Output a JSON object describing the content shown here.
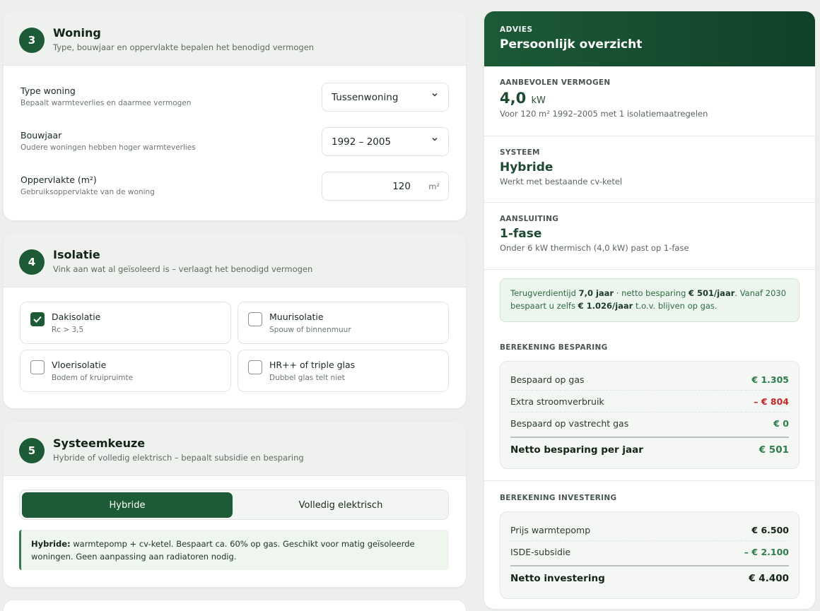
{
  "woning": {
    "step": "3",
    "title": "Woning",
    "subtitle": "Type, bouwjaar en oppervlakte bepalen het benodigd vermogen",
    "type_label": "Type woning",
    "type_help": "Bepaalt warmteverlies en daarmee vermogen",
    "type_value": "Tussenwoning",
    "bouwjaar_label": "Bouwjaar",
    "bouwjaar_help": "Oudere woningen hebben hoger warmteverlies",
    "bouwjaar_value": "1992 – 2005",
    "opp_label": "Oppervlakte (m²)",
    "opp_help": "Gebruiksoppervlakte van de woning",
    "opp_value": "120",
    "opp_unit": "m²"
  },
  "isolatie": {
    "step": "4",
    "title": "Isolatie",
    "subtitle": "Vink aan wat al geïsoleerd is – verlaagt het benodigd vermogen",
    "options": [
      {
        "title": "Dakisolatie",
        "sub": "Rc > 3,5",
        "checked": true
      },
      {
        "title": "Muurisolatie",
        "sub": "Spouw of binnenmuur",
        "checked": false
      },
      {
        "title": "Vloerisolatie",
        "sub": "Bodem of kruipruimte",
        "checked": false
      },
      {
        "title": "HR++ of triple glas",
        "sub": "Dubbel glas telt niet",
        "checked": false
      }
    ]
  },
  "systeem": {
    "step": "5",
    "title": "Systeemkeuze",
    "subtitle": "Hybride of volledig elektrisch – bepaalt subsidie en besparing",
    "opt_hybride": "Hybride",
    "opt_elektrisch": "Volledig elektrisch",
    "note_bold": "Hybride:",
    "note_text": " warmtepomp + cv-ketel. Bespaart ca. 60% op gas. Geschikt voor matig geïsoleerde woningen. Geen aanpassing aan radiatoren nodig."
  },
  "advies": {
    "eyebrow": "ADVIES",
    "title": "Persoonlijk overzicht",
    "vermogen_label": "AANBEVOLEN VERMOGEN",
    "vermogen_value": "4,0",
    "vermogen_unit": "kW",
    "vermogen_desc": "Voor 120 m² 1992–2005 met 1 isolatiemaatregelen",
    "systeem_label": "SYSTEEM",
    "systeem_value": "Hybride",
    "systeem_desc": "Werkt met bestaande cv-ketel",
    "aansluiting_label": "AANSLUITING",
    "aansluiting_value": "1-fase",
    "aansluiting_desc": "Onder 6 kW thermisch (4,0 kW) past op 1-fase",
    "payback_1": "Terugverdientijd ",
    "payback_2": "7,0 jaar",
    "payback_3": " · netto besparing ",
    "payback_4": "€ 501/jaar",
    "payback_5": ". Vanaf 2030 bespaart u zelfs ",
    "payback_6": "€ 1.026/jaar",
    "payback_7": " t.o.v. blijven op gas.",
    "besparing_label": "BEREKENING BESPARING",
    "besparing_rows": [
      {
        "label": "Bespaard op gas",
        "value": "€ 1.305"
      },
      {
        "label": "Extra stroomverbruik",
        "value": "– € 804"
      },
      {
        "label": "Bespaard op vastrecht gas",
        "value": "€ 0"
      }
    ],
    "besparing_total_label": "Netto besparing per jaar",
    "besparing_total_value": "€ 501",
    "investering_label": "BEREKENING INVESTERING",
    "investering_rows": [
      {
        "label": "Prijs warmtepomp",
        "value": "€ 6.500"
      },
      {
        "label": "ISDE-subsidie",
        "value": "– € 2.100"
      }
    ],
    "investering_total_label": "Netto investering",
    "investering_total_value": "€ 4.400"
  },
  "colors": {
    "brand_green": "#1d5a36",
    "positive": "#2e7d4a",
    "negative": "#c62828"
  }
}
